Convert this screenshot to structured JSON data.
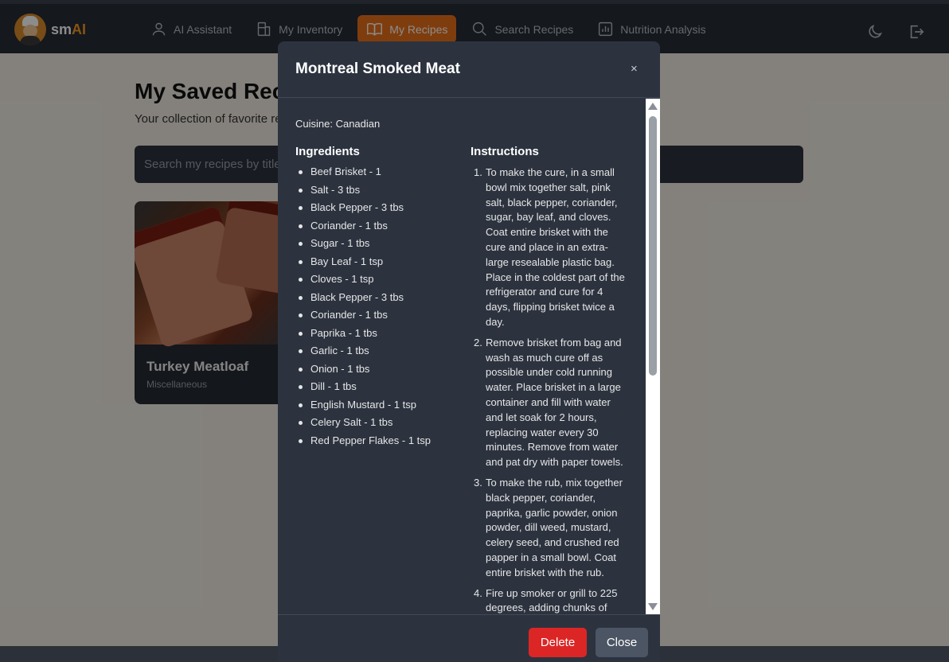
{
  "nav": {
    "brand_prefix": "sm",
    "brand_suffix": "AI",
    "items": [
      {
        "label": "AI Assistant",
        "icon": "user-icon"
      },
      {
        "label": "My Inventory",
        "icon": "inventory-icon"
      },
      {
        "label": "My Recipes",
        "icon": "book-icon",
        "active": true
      },
      {
        "label": "Search Recipes",
        "icon": "search-icon"
      },
      {
        "label": "Nutrition Analysis",
        "icon": "chart-icon"
      }
    ],
    "right_icons": [
      "moon-icon",
      "logout-icon"
    ]
  },
  "page": {
    "title": "My Saved Rec",
    "subtitle": "Your collection of favorite re",
    "search_placeholder": "Search my recipes by title"
  },
  "card": {
    "title": "Turkey Meatloaf",
    "category": "Miscellaneous"
  },
  "modal": {
    "title": "Montreal Smoked Meat",
    "close_symbol": "×",
    "cuisine": "Cuisine: Canadian",
    "ingredients_heading": "Ingredients",
    "instructions_heading": "Instructions",
    "ingredients": [
      "Beef Brisket - 1",
      "Salt - 3 tbs",
      "Black Pepper - 3 tbs",
      "Coriander - 1 tbs",
      "Sugar - 1 tbs",
      "Bay Leaf - 1 tsp",
      "Cloves - 1 tsp",
      "Black Pepper - 3 tbs",
      "Coriander - 1 tbs",
      "Paprika - 1 tbs",
      "Garlic - 1 tbs",
      "Onion - 1 tbs",
      "Dill - 1 tbs",
      "English Mustard - 1 tsp",
      "Celery Salt - 1 tbs",
      "Red Pepper Flakes - 1 tsp"
    ],
    "instructions": [
      {
        "num": "1.",
        "text": "To make the cure, in a small bowl mix together salt, pink salt, black pepper, coriander, sugar, bay leaf, and cloves. Coat entire brisket with the cure and place in an extra-large resealable plastic bag. Place in the coldest part of the refrigerator and cure for 4 days, flipping brisket twice a day."
      },
      {
        "num": "2.",
        "text": "Remove brisket from bag and wash as much cure off as possible under cold running water. Place brisket in a large container and fill with water and let soak for 2 hours, replacing water every 30 minutes. Remove from water and pat dry with paper towels."
      },
      {
        "num": "3.",
        "text": "To make the rub, mix together black pepper, coriander, paprika, garlic powder, onion powder, dill weed, mustard, celery seed, and crushed red papper in a small bowl. Coat entire brisket with the rub."
      },
      {
        "num": "4.",
        "text": "Fire up smoker or grill to 225 degrees, adding chunks of"
      }
    ],
    "delete_label": "Delete",
    "close_label": "Close"
  }
}
